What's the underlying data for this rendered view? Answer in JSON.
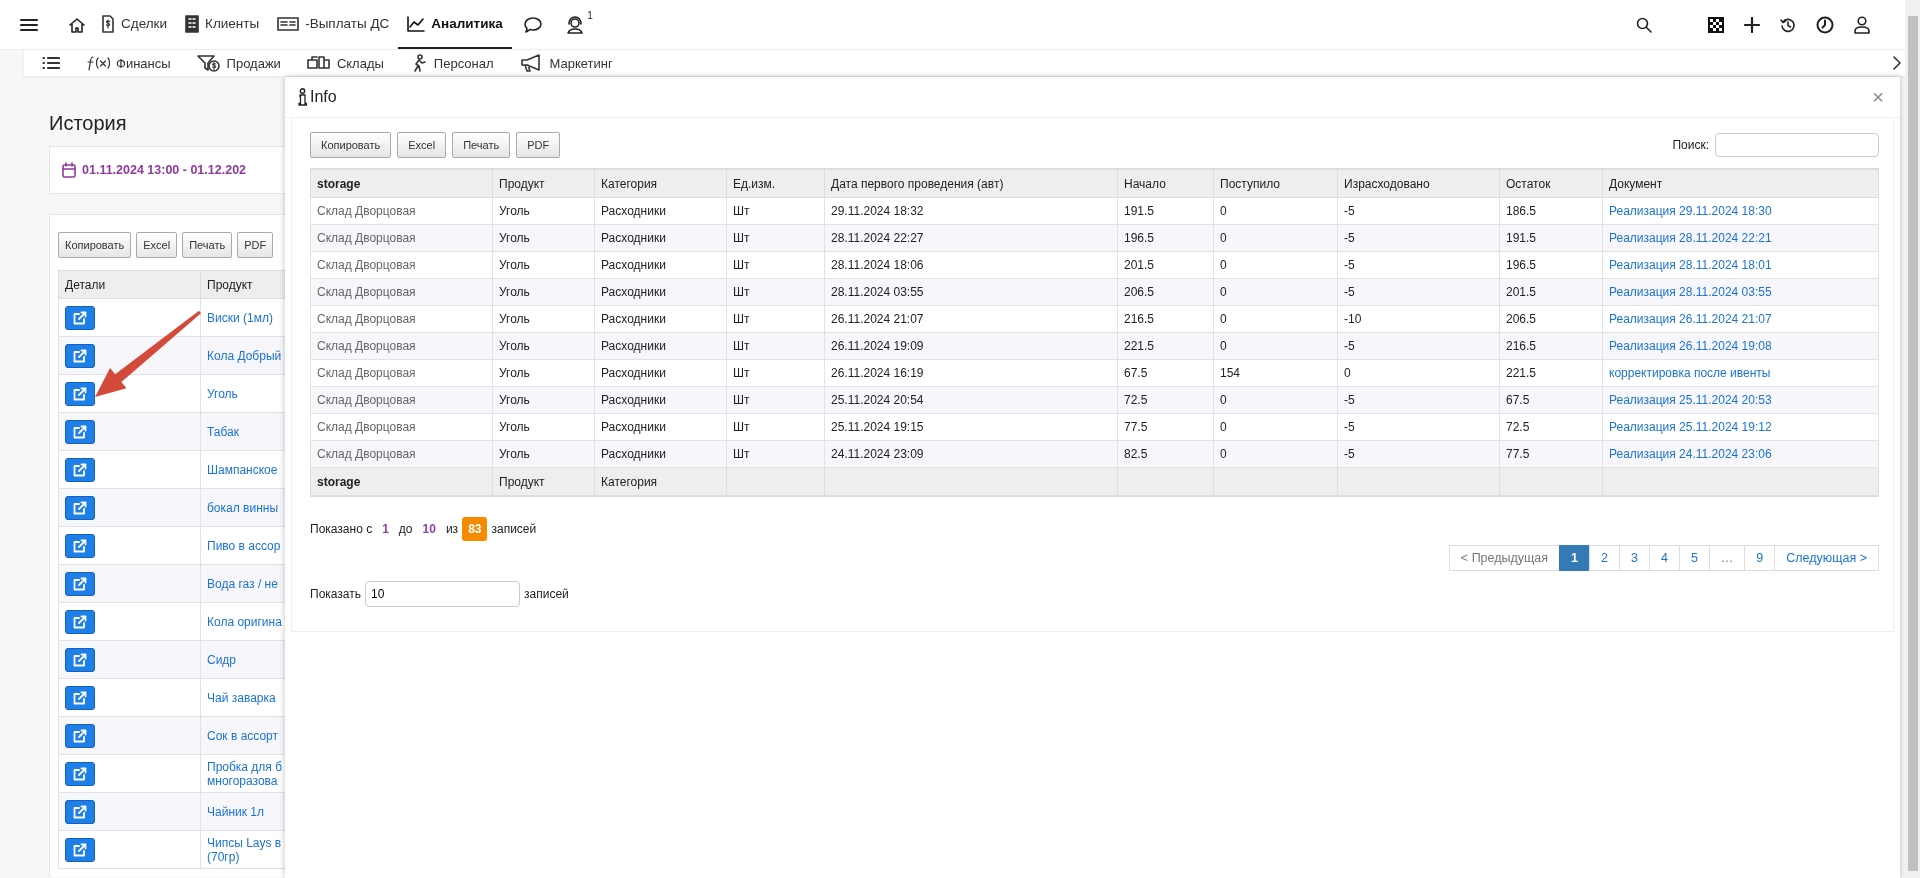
{
  "top_nav": {
    "items": [
      {
        "label": "Сделки",
        "selected": false
      },
      {
        "label": "Клиенты",
        "selected": false
      },
      {
        "label": "-Выплаты ДС",
        "selected": false
      },
      {
        "label": "Аналитика",
        "selected": true
      }
    ],
    "badge": "1"
  },
  "sub_nav": {
    "items": [
      "Финансы",
      "Продажи",
      "Склады",
      "Персонал",
      "Маркетинг"
    ]
  },
  "page": {
    "title": "История",
    "date_range": "01.11.2024 13:00 - 01.12.202",
    "buttons": [
      "Копировать",
      "Excel",
      "Печать",
      "PDF"
    ],
    "columns": [
      "Детали",
      "Продукт"
    ],
    "rows": [
      "Виски (1мл)",
      "Кола Добрый",
      "Уголь",
      "Табак",
      "Шампанское",
      "бокал винны",
      "Пиво в ассор",
      "Вода газ / не",
      "Кола оригина",
      "Сидр",
      "Чай заварка",
      "Сок в ассорт",
      "Пробка для б\nмногоразова",
      "Чайник 1л",
      "Чипсы Lays в\n(70гр)"
    ]
  },
  "modal": {
    "title": "Info",
    "close": "×",
    "buttons": [
      "Копировать",
      "Excel",
      "Печать",
      "PDF"
    ],
    "search_label": "Поиск:",
    "columns": [
      "storage",
      "Продукт",
      "Категория",
      "Ед.изм.",
      "Дата первого проведения (авт)",
      "Начало",
      "Поступило",
      "Израсходовано",
      "Остаток",
      "Документ"
    ],
    "rows": [
      [
        "Склад Дворцовая",
        "Уголь",
        "Расходники",
        "Шт",
        "29.11.2024 18:32",
        "191.5",
        "0",
        "-5",
        "186.5",
        "Реализация 29.11.2024 18:30"
      ],
      [
        "Склад Дворцовая",
        "Уголь",
        "Расходники",
        "Шт",
        "28.11.2024 22:27",
        "196.5",
        "0",
        "-5",
        "191.5",
        "Реализация 28.11.2024 22:21"
      ],
      [
        "Склад Дворцовая",
        "Уголь",
        "Расходники",
        "Шт",
        "28.11.2024 18:06",
        "201.5",
        "0",
        "-5",
        "196.5",
        "Реализация 28.11.2024 18:01"
      ],
      [
        "Склад Дворцовая",
        "Уголь",
        "Расходники",
        "Шт",
        "28.11.2024 03:55",
        "206.5",
        "0",
        "-5",
        "201.5",
        "Реализация 28.11.2024 03:55"
      ],
      [
        "Склад Дворцовая",
        "Уголь",
        "Расходники",
        "Шт",
        "26.11.2024 21:07",
        "216.5",
        "0",
        "-10",
        "206.5",
        "Реализация 26.11.2024 21:07"
      ],
      [
        "Склад Дворцовая",
        "Уголь",
        "Расходники",
        "Шт",
        "26.11.2024 19:09",
        "221.5",
        "0",
        "-5",
        "216.5",
        "Реализация 26.11.2024 19:08"
      ],
      [
        "Склад Дворцовая",
        "Уголь",
        "Расходники",
        "Шт",
        "26.11.2024 16:19",
        "67.5",
        "154",
        "0",
        "221.5",
        "корректировка после ивенты"
      ],
      [
        "Склад Дворцовая",
        "Уголь",
        "Расходники",
        "Шт",
        "25.11.2024 20:54",
        "72.5",
        "0",
        "-5",
        "67.5",
        "Реализация 25.11.2024 20:53"
      ],
      [
        "Склад Дворцовая",
        "Уголь",
        "Расходники",
        "Шт",
        "25.11.2024 19:15",
        "77.5",
        "0",
        "-5",
        "72.5",
        "Реализация 25.11.2024 19:12"
      ],
      [
        "Склад Дворцовая",
        "Уголь",
        "Расходники",
        "Шт",
        "24.11.2024 23:09",
        "82.5",
        "0",
        "-5",
        "77.5",
        "Реализация 24.11.2024 23:06"
      ]
    ],
    "footer": [
      "storage",
      "Продукт",
      "Категория"
    ],
    "info": {
      "prefix": "Показано с",
      "from": "1",
      "to_label": "до",
      "to": "10",
      "of_label": "из",
      "total": "83",
      "suffix": "записей"
    },
    "pagination": [
      {
        "label": "< Предыдущая",
        "selected": false,
        "disabled": true
      },
      {
        "label": "1",
        "selected": true,
        "disabled": false
      },
      {
        "label": "2",
        "selected": false,
        "disabled": false
      },
      {
        "label": "3",
        "selected": false,
        "disabled": false
      },
      {
        "label": "4",
        "selected": false,
        "disabled": false
      },
      {
        "label": "5",
        "selected": false,
        "disabled": false
      },
      {
        "label": "…",
        "selected": false,
        "disabled": true
      },
      {
        "label": "9",
        "selected": false,
        "disabled": false
      },
      {
        "label": "Следующая >",
        "selected": false,
        "disabled": false
      }
    ],
    "length": {
      "label": "Показать",
      "value": "10",
      "suffix": "записей"
    }
  }
}
